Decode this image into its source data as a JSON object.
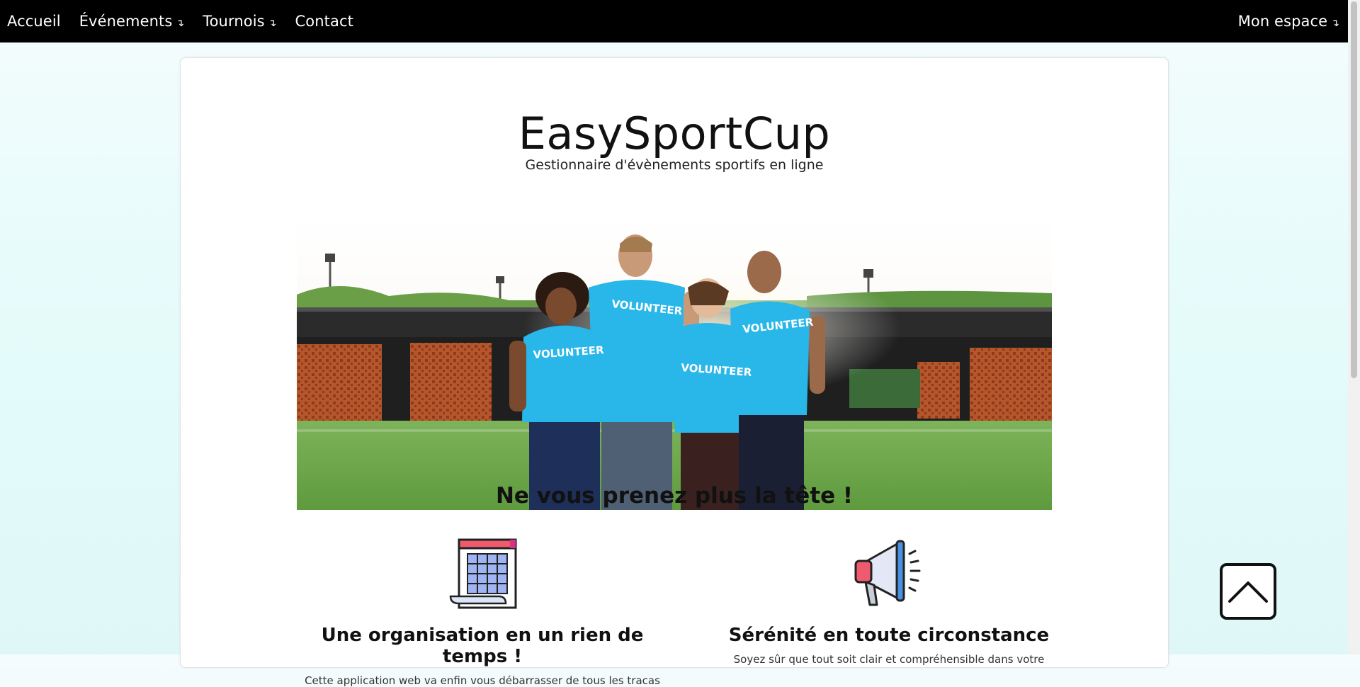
{
  "nav": {
    "home": "Accueil",
    "events": "Événements",
    "tournaments": "Tournois",
    "contact": "Contact",
    "my_space": "Mon espace",
    "caret": "↴"
  },
  "hero": {
    "brand": "EasySportCup",
    "tagline": "Gestionnaire d'évènements sportifs en ligne",
    "shirt_text": "VOLUNTEER"
  },
  "section": {
    "title": "Ne vous prenez plus la tête !"
  },
  "features": [
    {
      "icon": "calendar-icon",
      "title": "Une organisation en un rien de temps !",
      "text": "Cette application web va enfin vous débarrasser de tous les tracas"
    },
    {
      "icon": "megaphone-icon",
      "title": "Sérénité en toute circonstance",
      "text": "Soyez sûr que tout soit clair et compréhensible dans votre"
    }
  ],
  "back_to_top": {
    "icon": "chevron-up-icon"
  },
  "colors": {
    "nav_bg": "#000000",
    "accent_shirt": "#29b6e8",
    "calendar_header": "#f05a6f",
    "calendar_cells": "#9fb4f2",
    "megaphone_red": "#f05a6f",
    "megaphone_blue": "#4a8fe0"
  }
}
